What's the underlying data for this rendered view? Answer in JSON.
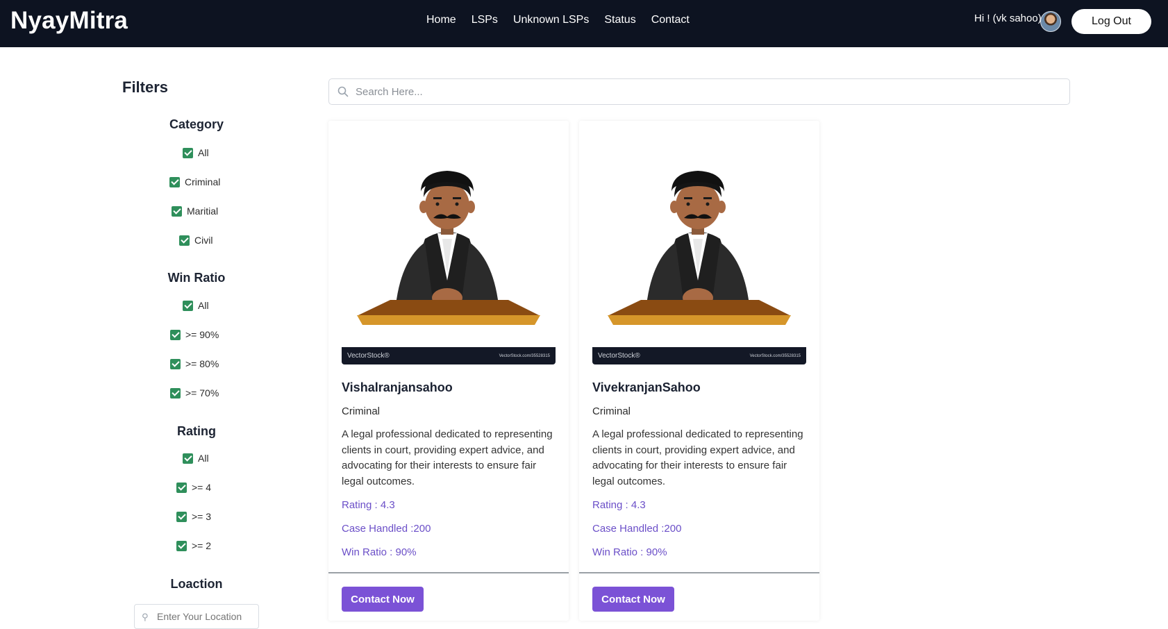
{
  "header": {
    "brand": "NyayMitra",
    "nav": [
      "Home",
      "LSPs",
      "Unknown LSPs",
      "Status",
      "Contact"
    ],
    "greeting": "Hi ! (vk sahoo)",
    "logout_label": "Log Out"
  },
  "filters": {
    "title": "Filters",
    "category": {
      "title": "Category",
      "options": [
        "All",
        "Criminal",
        "Maritial",
        "Civil"
      ]
    },
    "win_ratio": {
      "title": "Win Ratio",
      "options": [
        "All",
        ">= 90%",
        ">= 80%",
        ">= 70%"
      ]
    },
    "rating": {
      "title": "Rating",
      "options": [
        "All",
        ">= 4",
        ">= 3",
        ">= 2"
      ]
    },
    "location": {
      "title": "Loaction",
      "placeholder": "Enter Your Location"
    }
  },
  "search": {
    "placeholder": "Search Here..."
  },
  "cards": [
    {
      "watermark_left": "VectorStock®",
      "watermark_right": "VectorStock.com/35528315",
      "name": "Vishalranjansahoo",
      "category": "Criminal",
      "description": "A legal professional dedicated to representing clients in court, providing expert advice, and advocating for their interests to ensure fair legal outcomes.",
      "rating": "Rating : 4.3",
      "cases": "Case Handled :200",
      "win_ratio": "Win Ratio : 90%",
      "button": "Contact Now"
    },
    {
      "watermark_left": "VectorStock®",
      "watermark_right": "VectorStock.com/35528315",
      "name": "VivekranjanSahoo",
      "category": "Criminal",
      "description": "A legal professional dedicated to representing clients in court, providing expert advice, and advocating for their interests to ensure fair legal outcomes.",
      "rating": "Rating : 4.3",
      "cases": "Case Handled :200",
      "win_ratio": "Win Ratio : 90%",
      "button": "Contact Now"
    }
  ],
  "colors": {
    "header_bg": "#0d1321",
    "checkbox": "#2f8f5b",
    "accent": "#7b52d6",
    "stat_text": "#6b4fc8"
  }
}
